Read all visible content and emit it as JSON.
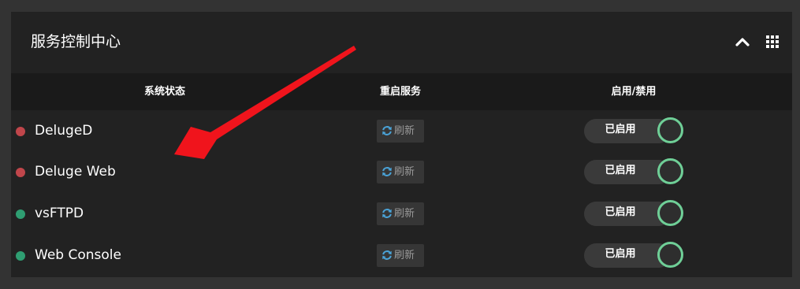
{
  "panel": {
    "title": "服务控制中心",
    "collapse_icon": "chevron-up-icon",
    "grid_icon": "grid-icon"
  },
  "columns": {
    "status": "系统状态",
    "restart": "重启服务",
    "toggle": "启用/禁用"
  },
  "services": [
    {
      "name": "DelugeD",
      "status": "stopped",
      "dot_color": "#c0464b",
      "refresh_label": "刷新",
      "toggle_label": "已启用"
    },
    {
      "name": "Deluge Web",
      "status": "stopped",
      "dot_color": "#c0464b",
      "refresh_label": "刷新",
      "toggle_label": "已启用"
    },
    {
      "name": "vsFTPD",
      "status": "running",
      "dot_color": "#2f9e72",
      "refresh_label": "刷新",
      "toggle_label": "已启用"
    },
    {
      "name": "Web Console",
      "status": "running",
      "dot_color": "#2f9e72",
      "refresh_label": "刷新",
      "toggle_label": "已启用"
    }
  ],
  "colors": {
    "accent_green": "#6fcf97",
    "status_red": "#c0464b",
    "status_green": "#2f9e72",
    "refresh_icon": "#4aa3d8",
    "annotation_arrow": "#f0141c"
  }
}
